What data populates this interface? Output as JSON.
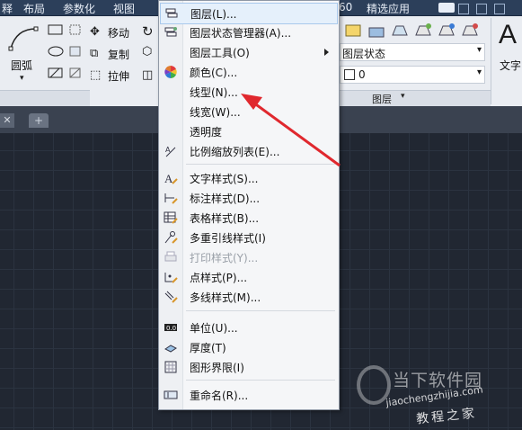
{
  "menubar": {
    "items": [
      "释",
      "布局",
      "参数化",
      "视图",
      "60",
      "精选应用"
    ]
  },
  "ribbon": {
    "modify": {
      "move": "移动",
      "copy": "复制",
      "stretch": "拉伸"
    },
    "draw": {
      "arc": "圆弧"
    },
    "layer": {
      "state": "图层状态",
      "value": "0",
      "panel_title": "图层"
    },
    "text": {
      "label": "文字"
    }
  },
  "menu": {
    "items": [
      {
        "label": "图层(L)...",
        "icon": "layers-icon",
        "disabled": false,
        "submenu": false,
        "highlight": true
      },
      {
        "label": "图层状态管理器(A)...",
        "icon": "layer-state-icon",
        "disabled": false,
        "submenu": false
      },
      {
        "label": "图层工具(O)",
        "icon": "",
        "disabled": false,
        "submenu": true
      },
      {
        "label": "颜色(C)...",
        "icon": "color-wheel-icon",
        "disabled": false,
        "submenu": false
      },
      {
        "label": "线型(N)...",
        "icon": "",
        "disabled": false,
        "submenu": false
      },
      {
        "label": "线宽(W)...",
        "icon": "",
        "disabled": false,
        "submenu": false
      },
      {
        "label": "透明度",
        "icon": "",
        "disabled": false,
        "submenu": false
      },
      {
        "label": "比例缩放列表(E)...",
        "icon": "scale-list-icon",
        "disabled": false,
        "submenu": false
      },
      {
        "label": "文字样式(S)...",
        "icon": "text-style-icon",
        "disabled": false,
        "submenu": false
      },
      {
        "label": "标注样式(D)...",
        "icon": "dimension-style-icon",
        "disabled": false,
        "submenu": false
      },
      {
        "label": "表格样式(B)...",
        "icon": "table-style-icon",
        "disabled": false,
        "submenu": false
      },
      {
        "label": "多重引线样式(I)",
        "icon": "multileader-style-icon",
        "disabled": false,
        "submenu": false
      },
      {
        "label": "打印样式(Y)...",
        "icon": "print-style-icon",
        "disabled": true,
        "submenu": false
      },
      {
        "label": "点样式(P)...",
        "icon": "point-style-icon",
        "disabled": false,
        "submenu": false
      },
      {
        "label": "多线样式(M)...",
        "icon": "multiline-style-icon",
        "disabled": false,
        "submenu": false
      },
      {
        "label": "单位(U)...",
        "icon": "units-icon",
        "disabled": false,
        "submenu": false
      },
      {
        "label": "厚度(T)",
        "icon": "thickness-icon",
        "disabled": false,
        "submenu": false
      },
      {
        "label": "图形界限(I)",
        "icon": "drawing-limits-icon",
        "disabled": false,
        "submenu": false
      },
      {
        "label": "重命名(R)...",
        "icon": "rename-icon",
        "disabled": false,
        "submenu": false
      }
    ]
  },
  "watermark": {
    "title": "当下软件园",
    "url": "jiaochengzhijia.com",
    "sub": "教程之家"
  },
  "colors": {
    "arrow": "#e0282e",
    "canvas": "#212732",
    "menubar": "#2c3f5a"
  }
}
